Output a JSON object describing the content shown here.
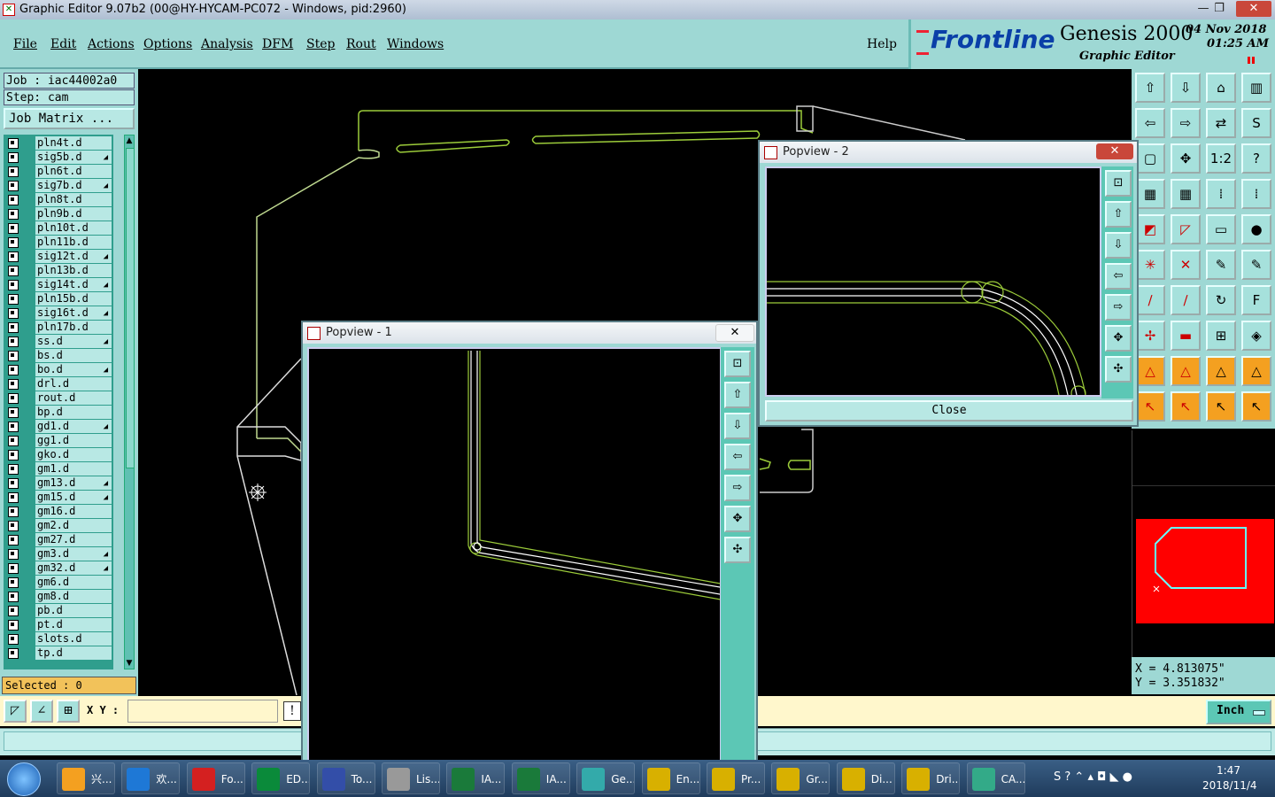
{
  "window": {
    "title": "Graphic Editor 9.07b2 (00@HY-HYCAM-PC072 - Windows, pid:2960)",
    "controls": [
      "—",
      "❐",
      "✕"
    ]
  },
  "menu": {
    "items": [
      "File",
      "Edit",
      "Actions",
      "Options",
      "Analysis",
      "DFM",
      "Step",
      "Rout",
      "Windows"
    ],
    "help": "Help"
  },
  "brand": {
    "logo": "Frontline",
    "product": "Genesis 2000",
    "subtitle": "Graphic Editor",
    "date": "04 Nov 2018",
    "time": "01:25 AM"
  },
  "job": {
    "job_line": "Job : iac44002a0",
    "step_line": "Step: cam",
    "matrix_button": "Job Matrix ..."
  },
  "layers": [
    {
      "name": "pln4t.d",
      "marked": false
    },
    {
      "name": "sig5b.d",
      "marked": true
    },
    {
      "name": "pln6t.d",
      "marked": false
    },
    {
      "name": "sig7b.d",
      "marked": true
    },
    {
      "name": "pln8t.d",
      "marked": false
    },
    {
      "name": "pln9b.d",
      "marked": false
    },
    {
      "name": "pln10t.d",
      "marked": false
    },
    {
      "name": "pln11b.d",
      "marked": false
    },
    {
      "name": "sig12t.d",
      "marked": true
    },
    {
      "name": "pln13b.d",
      "marked": false
    },
    {
      "name": "sig14t.d",
      "marked": true
    },
    {
      "name": "pln15b.d",
      "marked": false
    },
    {
      "name": "sig16t.d",
      "marked": true
    },
    {
      "name": "pln17b.d",
      "marked": false
    },
    {
      "name": "ss.d",
      "marked": true
    },
    {
      "name": "bs.d",
      "marked": false
    },
    {
      "name": "bo.d",
      "marked": true
    },
    {
      "name": "drl.d",
      "marked": false
    },
    {
      "name": "rout.d",
      "marked": false
    },
    {
      "name": "bp.d",
      "marked": false
    },
    {
      "name": "gd1.d",
      "marked": true
    },
    {
      "name": "gg1.d",
      "marked": false
    },
    {
      "name": "gko.d",
      "marked": false
    },
    {
      "name": "gm1.d",
      "marked": false
    },
    {
      "name": "gm13.d",
      "marked": true
    },
    {
      "name": "gm15.d",
      "marked": true
    },
    {
      "name": "gm16.d",
      "marked": false
    },
    {
      "name": "gm2.d",
      "marked": false
    },
    {
      "name": "gm27.d",
      "marked": false
    },
    {
      "name": "gm3.d",
      "marked": true
    },
    {
      "name": "gm32.d",
      "marked": true
    },
    {
      "name": "gm6.d",
      "marked": false
    },
    {
      "name": "gm8.d",
      "marked": false
    },
    {
      "name": "pb.d",
      "marked": false
    },
    {
      "name": "pt.d",
      "marked": false
    },
    {
      "name": "slots.d",
      "marked": false
    },
    {
      "name": "tp.d",
      "marked": false
    }
  ],
  "status": {
    "selected": "Selected : 0",
    "xy_label": "X Y :",
    "xy_value": "",
    "units": "Inch",
    "coord_x": "X = 4.813075\"",
    "coord_y": "Y = 3.351832\""
  },
  "popup1": {
    "title": "Popview - 1",
    "close_icon": "✕"
  },
  "popup2": {
    "title": "Popview - 2",
    "close_icon": "✕",
    "close_button": "Close"
  },
  "toolbox_icons": [
    "zoom-home",
    "zoom-out",
    "home-view",
    "panels",
    "pan-left",
    "pan-right",
    "mirror",
    "undo-curve",
    "box-zoom",
    "center",
    "1:2",
    "help",
    "grid-settings",
    "grid",
    "snap-red",
    "snap-red-2",
    "line-tool",
    "slash-tool",
    "ruler",
    "pad",
    "connect",
    "cross",
    "draw-point",
    "draw-point-2",
    "pen",
    "pen-2",
    "arc",
    "text-tool",
    "edit-point",
    "line-edit",
    "measure",
    "shapes",
    "triangle",
    "triangle-2",
    "triangle-3",
    "triangle-4",
    "select",
    "select-2",
    "select-3",
    "select-4"
  ],
  "toolbox_glyphs": [
    "⇧",
    "⇩",
    "⌂",
    "▥",
    "⇦",
    "⇨",
    "⇄",
    "S",
    "▢",
    "✥",
    "1:2",
    "?",
    "▦",
    "▦",
    "⁞",
    "⁞",
    "◩",
    "◸",
    "▭",
    "●",
    "✳",
    "✕",
    "✎",
    "✎",
    "∕",
    "∕",
    "↻",
    "F",
    "✢",
    "▬",
    "⊞",
    "◈",
    "△",
    "△",
    "△",
    "△",
    "↖",
    "↖",
    "↖",
    "↖"
  ],
  "taskbar": {
    "items": [
      "兴...",
      "欢...",
      "Fo...",
      "ED...",
      "To...",
      "Lis...",
      "IA...",
      "IA...",
      "Ge...",
      "En...",
      "Pr...",
      "Gr...",
      "Di...",
      "Dri...",
      "CA..."
    ],
    "clock_time": "1:47",
    "clock_date": "2018/11/4"
  }
}
